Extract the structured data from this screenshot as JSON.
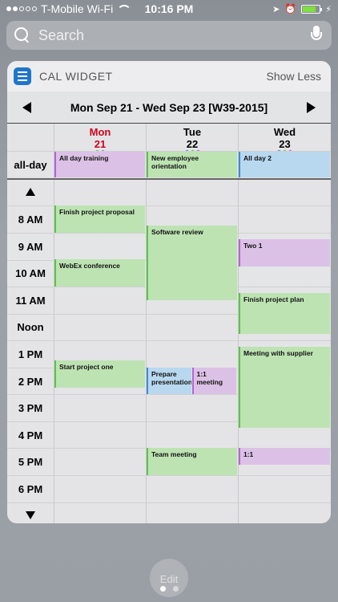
{
  "status": {
    "carrier": "T-Mobile Wi-Fi",
    "time": "10:16 PM"
  },
  "search": {
    "placeholder": "Search"
  },
  "widget": {
    "title": "CAL WIDGET",
    "show_less": "Show Less",
    "date_range": "Mon Sep 21 - Wed Sep 23 [W39-2015]",
    "all_day_label": "all-day",
    "days": [
      {
        "name": "Mon",
        "num": "21",
        "today": true
      },
      {
        "name": "Tue",
        "num": "22",
        "today": false
      },
      {
        "name": "Wed",
        "num": "23",
        "today": false
      }
    ],
    "hours": [
      "8 AM",
      "9 AM",
      "10 AM",
      "11 AM",
      "Noon",
      "1 PM",
      "2 PM",
      "3 PM",
      "4 PM",
      "5 PM",
      "6 PM"
    ],
    "all_day_events": [
      {
        "day": 0,
        "title": "All day training",
        "color": "purple"
      },
      {
        "day": 1,
        "title": "New employee orientation",
        "color": "green"
      },
      {
        "day": 2,
        "title": "All day 2",
        "color": "blue"
      }
    ],
    "events": [
      {
        "day": 0,
        "title": "Finish project proposal",
        "start": 8.0,
        "end": 9.0,
        "color": "green",
        "col": 0,
        "cols": 1
      },
      {
        "day": 0,
        "title": "WebEx conference",
        "start": 10.0,
        "end": 11.0,
        "color": "green",
        "col": 0,
        "cols": 1
      },
      {
        "day": 0,
        "title": "Start project one",
        "start": 13.75,
        "end": 14.75,
        "color": "green",
        "col": 0,
        "cols": 1
      },
      {
        "day": 1,
        "title": "Software review",
        "start": 8.75,
        "end": 11.5,
        "color": "green",
        "col": 0,
        "cols": 1
      },
      {
        "day": 1,
        "title": "Prepare presentation",
        "start": 14.0,
        "end": 15.0,
        "color": "blue",
        "col": 0,
        "cols": 2
      },
      {
        "day": 1,
        "title": "1:1 meeting",
        "start": 14.0,
        "end": 15.0,
        "color": "purple",
        "col": 1,
        "cols": 2
      },
      {
        "day": 1,
        "title": "Team meeting",
        "start": 17.0,
        "end": 18.0,
        "color": "green",
        "col": 0,
        "cols": 1
      },
      {
        "day": 2,
        "title": "Two 1",
        "start": 9.25,
        "end": 10.25,
        "color": "purple",
        "col": 0,
        "cols": 1
      },
      {
        "day": 2,
        "title": "Finish project plan",
        "start": 11.25,
        "end": 12.75,
        "color": "green",
        "col": 0,
        "cols": 1
      },
      {
        "day": 2,
        "title": "Meeting with supplier",
        "start": 13.25,
        "end": 16.25,
        "color": "green",
        "col": 0,
        "cols": 1
      },
      {
        "day": 2,
        "title": "1:1",
        "start": 17.0,
        "end": 17.6,
        "color": "purple",
        "col": 0,
        "cols": 1
      }
    ],
    "dot_colors": {
      "green": "#5cc24a",
      "purple": "#b463d6",
      "blue": "#3a8ed8"
    },
    "day_dots": [
      [
        "green",
        "purple"
      ],
      [
        "blue",
        "green",
        "purple"
      ],
      [
        "blue",
        "green",
        "purple"
      ]
    ]
  },
  "edit_label": "Edit"
}
